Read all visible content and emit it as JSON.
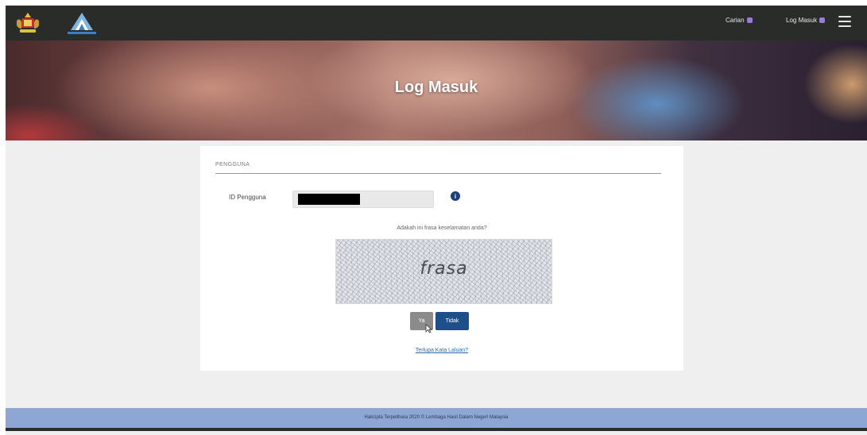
{
  "topbar": {
    "logo1_icon": "malaysia-coat-of-arms-icon",
    "logo2_icon": "lhdn-logo-icon",
    "nav_bahasa_label": "Carian",
    "nav_login_label": "Log Masuk",
    "menu_icon": "hamburger-icon"
  },
  "hero": {
    "title": "Log Masuk"
  },
  "form": {
    "section_title": "PENGGUNA",
    "id_label": "ID Pengguna",
    "id_value": "",
    "help_icon": "info-icon",
    "question": "Adakah ini frasa keselamatan anda?",
    "security_phrase": "frasa",
    "yes_label": "Ya",
    "no_label": "Tidak",
    "forgot_link": "Terlupa Kata Laluan?"
  },
  "footer": {
    "text": "Hakcipta Terpelihara 2020 © Lembaga Hasil Dalam Negeri Malaysia"
  },
  "colors": {
    "topbar": "#2a2c2a",
    "primary_button": "#1d4f8a",
    "secondary_button": "#8b8b8b",
    "footer": "#8ea6d4",
    "link": "#2b6aa8"
  }
}
